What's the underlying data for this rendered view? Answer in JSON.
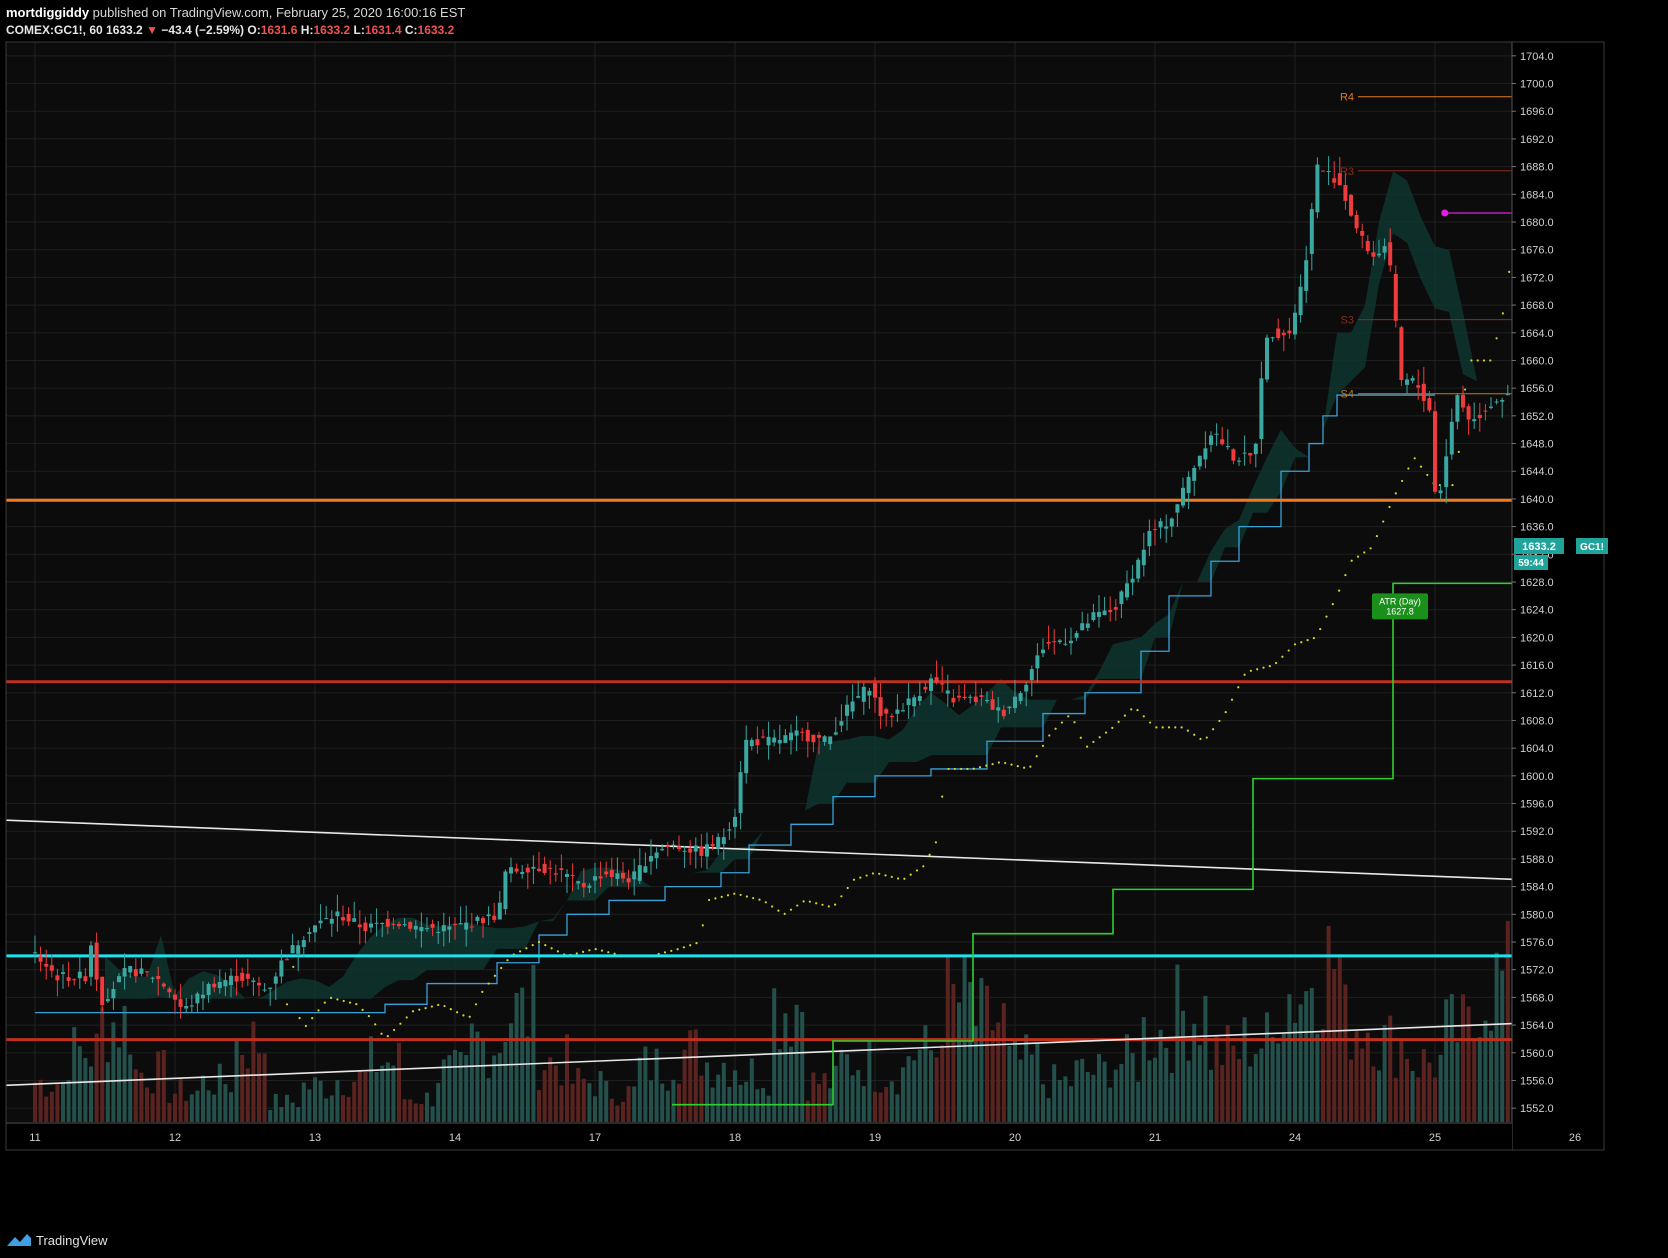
{
  "header": {
    "publisher": "mortdiggiddy",
    "published_text": "published on TradingView.com, February 25, 2020 16:00:16 EST",
    "symbol": "COMEX:GC1!, 60",
    "last": "1633.2",
    "change_arrow": "▼",
    "change": "−43.4 (−2.59%)",
    "o_label": "O:",
    "o_value": "1631.6",
    "h_label": "H:",
    "h_value": "1633.2",
    "l_label": "L:",
    "l_value": "1631.4",
    "c_label": "C:",
    "c_value": "1633.2"
  },
  "footer": {
    "brand": "TradingView",
    "icon": "tradingview-logo-icon"
  },
  "colors": {
    "background": "#0c0c0c",
    "grid": "#1f1f1f",
    "up": "#3aa7a0",
    "down": "#ef3b3b",
    "volume_up": "#24504c",
    "volume_down": "#5a2320",
    "cyan_level": "#1ee2ee",
    "orange_level": "#f07a1e",
    "red_level": "#c0301e",
    "trendline": "#e8e8e8",
    "atr": "#2fd12f",
    "cloud": "#0f3530",
    "lower_band": "#3aa0d8",
    "dots": "#d6d62a",
    "pivot_r4": "#e07a1e",
    "pivot_r3": "#8a2a1e",
    "magenta": "#e020e0"
  },
  "chart_data": {
    "type": "candlestick",
    "symbol": "COMEX:GC1!",
    "interval": "60",
    "ylim": [
      1550,
      1706
    ],
    "y_ticks": [
      "1704.0",
      "1700.0",
      "1696.0",
      "1692.0",
      "1688.0",
      "1684.0",
      "1680.0",
      "1676.0",
      "1672.0",
      "1668.0",
      "1664.0",
      "1660.0",
      "1656.0",
      "1652.0",
      "1648.0",
      "1644.0",
      "1640.0",
      "1636.0",
      "1632.0",
      "1628.0",
      "1624.0",
      "1620.0",
      "1616.0",
      "1612.0",
      "1608.0",
      "1604.0",
      "1600.0",
      "1596.0",
      "1592.0",
      "1588.0",
      "1584.0",
      "1580.0",
      "1576.0",
      "1572.0",
      "1568.0",
      "1564.0",
      "1560.0",
      "1556.0",
      "1552.0"
    ],
    "x_ticks": [
      "11",
      "12",
      "13",
      "14",
      "17",
      "18",
      "19",
      "20",
      "21",
      "24",
      "25",
      "26"
    ],
    "x_tick_days": [
      0,
      1,
      2,
      3,
      4,
      5,
      6,
      7,
      8,
      9,
      10,
      11
    ],
    "close_path": [
      [
        0.0,
        1575
      ],
      [
        0.2,
        1571
      ],
      [
        0.4,
        1571
      ],
      [
        0.45,
        1577
      ],
      [
        0.5,
        1567
      ],
      [
        0.7,
        1572
      ],
      [
        0.9,
        1571
      ],
      [
        1.0,
        1569
      ],
      [
        1.1,
        1566
      ],
      [
        1.3,
        1570
      ],
      [
        1.5,
        1571
      ],
      [
        1.7,
        1569
      ],
      [
        1.8,
        1573
      ],
      [
        2.0,
        1578
      ],
      [
        2.2,
        1580
      ],
      [
        2.4,
        1578
      ],
      [
        2.6,
        1579
      ],
      [
        2.8,
        1578
      ],
      [
        3.0,
        1578
      ],
      [
        3.2,
        1579
      ],
      [
        3.35,
        1580
      ],
      [
        3.4,
        1586
      ],
      [
        3.6,
        1587
      ],
      [
        3.8,
        1586
      ],
      [
        3.95,
        1584
      ],
      [
        4.1,
        1586
      ],
      [
        4.3,
        1585
      ],
      [
        4.45,
        1589
      ],
      [
        4.6,
        1590
      ],
      [
        4.8,
        1589
      ],
      [
        4.95,
        1591
      ],
      [
        5.05,
        1595
      ],
      [
        5.1,
        1605
      ],
      [
        5.3,
        1605
      ],
      [
        5.5,
        1606
      ],
      [
        5.7,
        1605
      ],
      [
        5.85,
        1610
      ],
      [
        6.0,
        1613
      ],
      [
        6.1,
        1608
      ],
      [
        6.3,
        1611
      ],
      [
        6.45,
        1614
      ],
      [
        6.6,
        1611
      ],
      [
        6.8,
        1611
      ],
      [
        6.95,
        1609
      ],
      [
        7.1,
        1613
      ],
      [
        7.25,
        1619
      ],
      [
        7.45,
        1620
      ],
      [
        7.6,
        1623
      ],
      [
        7.75,
        1624
      ],
      [
        7.9,
        1630
      ],
      [
        8.0,
        1635
      ],
      [
        8.15,
        1637
      ],
      [
        8.3,
        1644
      ],
      [
        8.45,
        1650
      ],
      [
        8.6,
        1646
      ],
      [
        8.75,
        1646
      ],
      [
        8.8,
        1658
      ],
      [
        8.85,
        1664
      ],
      [
        9.0,
        1664
      ],
      [
        9.1,
        1672
      ],
      [
        9.2,
        1688
      ],
      [
        9.35,
        1686
      ],
      [
        9.5,
        1678
      ],
      [
        9.6,
        1675
      ],
      [
        9.7,
        1677
      ],
      [
        9.75,
        1667
      ],
      [
        9.8,
        1657
      ],
      [
        9.9,
        1657
      ],
      [
        10.0,
        1653
      ],
      [
        10.05,
        1638
      ],
      [
        10.15,
        1650
      ],
      [
        10.2,
        1655
      ],
      [
        10.3,
        1651
      ],
      [
        10.45,
        1654
      ],
      [
        10.55,
        1655
      ],
      [
        10.65,
        1649
      ],
      [
        10.7,
        1651
      ],
      [
        10.8,
        1639
      ],
      [
        10.9,
        1631
      ],
      [
        10.95,
        1633.2
      ]
    ],
    "volume_profile": [
      20,
      35,
      50,
      25,
      15,
      20,
      40,
      10,
      18,
      22,
      30,
      12,
      25,
      40,
      55,
      30,
      20,
      15,
      28,
      35,
      30,
      25,
      60,
      20,
      30,
      25,
      35,
      60,
      50,
      30,
      20,
      25,
      30,
      45,
      55,
      35,
      40,
      65,
      80,
      50,
      40,
      30,
      45,
      70,
      75,
      50
    ],
    "last_price": "1633.2",
    "last_price_label": "GC1!",
    "countdown": "59:44",
    "horizontal_levels": [
      {
        "name": "cyan-support",
        "value": 1574
      },
      {
        "name": "orange-resistance",
        "value": 1639.8
      },
      {
        "name": "red-level-upper",
        "value": 1613.6
      },
      {
        "name": "red-level-lower",
        "value": 1561.9
      }
    ],
    "pivots": [
      {
        "label": "R4",
        "value": 1698.1,
        "color": "#e07a1e"
      },
      {
        "label": "R3",
        "value": 1687.4,
        "color": "#8a2a1e"
      },
      {
        "label": "S3",
        "value": 1665.9,
        "color": "#8a2a1e"
      },
      {
        "label": "S4",
        "value": 1655.2,
        "color": "#c07a1e"
      }
    ],
    "magenta_marker": {
      "value": 1681.3
    },
    "trendlines": [
      {
        "name": "upper-trendline",
        "from": [
          0,
          1593.6
        ],
        "to": [
          11.5,
          1584.3
        ]
      },
      {
        "name": "lower-trendline",
        "from": [
          0,
          1555.3
        ],
        "to": [
          11.5,
          1565.0
        ]
      }
    ],
    "atr": {
      "label_title": "ATR (Day)",
      "label_value": "1627.8",
      "steps": [
        [
          4.55,
          1552.5
        ],
        [
          5.7,
          1561.7
        ],
        [
          6.7,
          1577.2
        ],
        [
          7.7,
          1583.6
        ],
        [
          8.7,
          1599.6
        ],
        [
          9.7,
          1627.8
        ],
        [
          10.85,
          1627.8
        ]
      ]
    },
    "lower_band_steps": [
      [
        0,
        1565.8
      ],
      [
        2.3,
        1565.8
      ],
      [
        2.5,
        1567
      ],
      [
        2.8,
        1570
      ],
      [
        3.3,
        1573
      ],
      [
        3.6,
        1577
      ],
      [
        3.8,
        1580
      ],
      [
        4.1,
        1582
      ],
      [
        4.5,
        1584
      ],
      [
        4.9,
        1586
      ],
      [
        5.1,
        1590
      ],
      [
        5.4,
        1593
      ],
      [
        5.7,
        1597
      ],
      [
        6.0,
        1600
      ],
      [
        6.4,
        1601
      ],
      [
        6.8,
        1605
      ],
      [
        7.2,
        1609
      ],
      [
        7.5,
        1612
      ],
      [
        7.9,
        1618
      ],
      [
        8.1,
        1626
      ],
      [
        8.4,
        1631
      ],
      [
        8.6,
        1636
      ],
      [
        8.9,
        1644
      ],
      [
        9.1,
        1648
      ],
      [
        9.2,
        1652
      ],
      [
        9.3,
        1655
      ],
      [
        10.0,
        1655
      ]
    ]
  }
}
